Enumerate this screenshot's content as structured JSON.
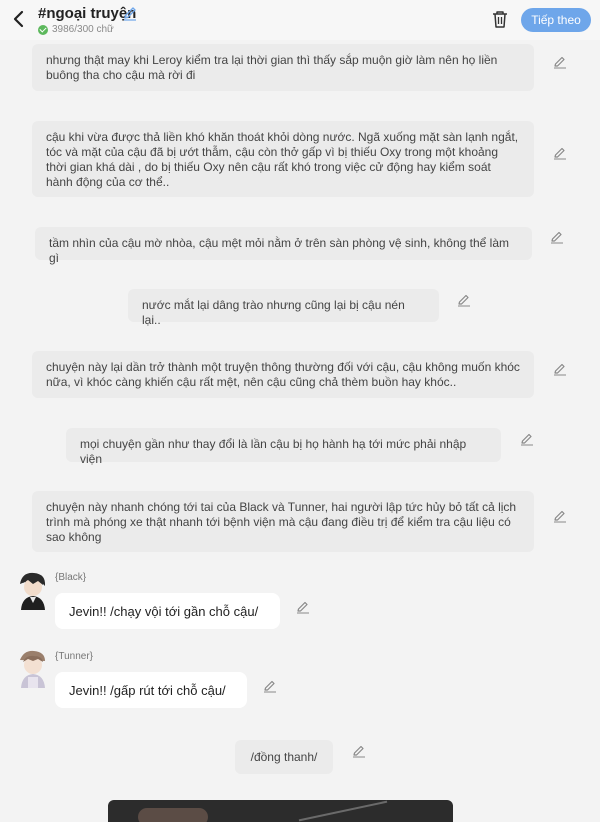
{
  "header": {
    "title": "#ngoại truyện",
    "word_count": "3986/300 chữ",
    "next_button": "Tiếp theo",
    "accent_color": "#6ea6ea"
  },
  "paragraphs": [
    "nhưng thật may khi Leroy kiểm tra lại thời gian thì thấy sắp muộn giờ làm nên họ liền buông tha cho cậu mà rời đi",
    "cậu khi vừa được thả liền khó khăn thoát khỏi dòng nước. Ngã xuống mặt sàn lạnh ngắt, tóc và mặt của cậu đã bị ướt thẫm, cậu còn thở gấp vì bị thiếu Oxy trong một khoảng thời gian khá dài , do bị thiếu Oxy nên cậu rất khó trong việc cử động hay kiểm soát hành động của cơ thể..",
    "tầm nhìn của cậu mờ nhòa, cậu mệt mỏi nằm ở trên sàn phòng vệ sinh, không thể làm gì",
    "nước mắt lại dâng trào nhưng cũng lại bị cậu nén lại..",
    "chuyện này lại dần trở thành một truyện thông thường đối với cậu, cậu không muốn khóc nữa, vì khóc càng khiến cậu rất mệt, nên cậu cũng chả thèm buồn hay khóc..",
    "mọi chuyện gần như thay đổi là lần cậu bị họ hành hạ tới mức phải nhập viện",
    "chuyện này nhanh chóng tới tai của Black và Tunner, hai người lập tức hủy bỏ tất cả lịch trình mà phóng xe thật nhanh tới bệnh viện mà cậu đang điều trị để kiểm tra cậu liệu có sao không"
  ],
  "dialogues": [
    {
      "name": "{Black}",
      "text": "Jevin!! /chạy vội tới gần chỗ cậu/"
    },
    {
      "name": "{Tunner}",
      "text": "Jevin!! /gấp rút tới chỗ cậu/"
    }
  ],
  "narration_last": "/đồng thanh/",
  "icons": {
    "back": "back-arrow-icon",
    "title_edit": "pencil-icon",
    "delete": "trash-icon",
    "edit": "pencil-icon"
  }
}
